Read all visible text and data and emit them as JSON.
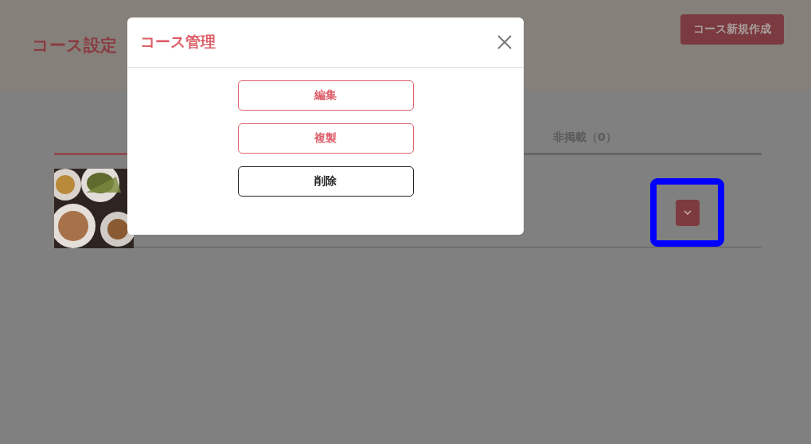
{
  "header": {
    "title": "コース設定",
    "new_course_button": "コース新規作成"
  },
  "tabs": [
    {
      "selected": true
    },
    {
      "label": "非掲載（0）",
      "selected": false
    }
  ],
  "course_rows": [
    {
      "menu_toggle": {
        "highlighted": true
      }
    }
  ],
  "modal": {
    "title": "コース管理",
    "actions": [
      {
        "label": "編集",
        "kind": "primary"
      },
      {
        "label": "複製",
        "kind": "primary"
      },
      {
        "label": "削除",
        "kind": "neutral"
      }
    ]
  }
}
